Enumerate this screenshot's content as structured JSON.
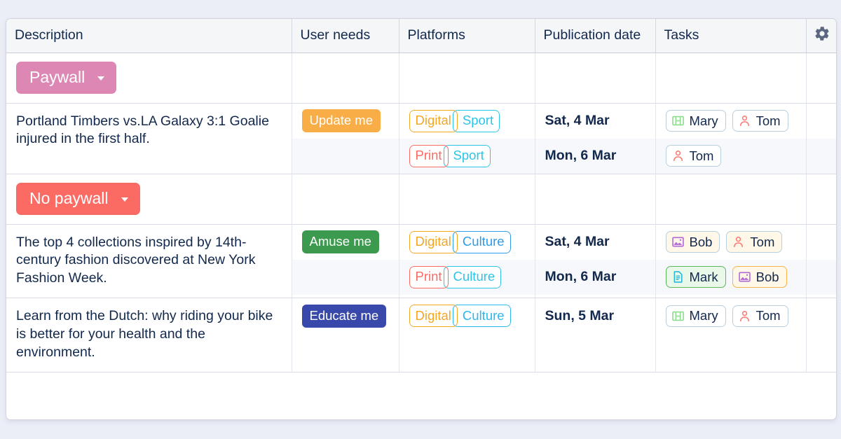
{
  "page": {
    "background_color": "#eceef7",
    "card_background": "#ffffff"
  },
  "table": {
    "columns": [
      {
        "key": "description",
        "label": "Description"
      },
      {
        "key": "user_needs",
        "label": "User needs"
      },
      {
        "key": "platforms",
        "label": "Platforms"
      },
      {
        "key": "publication_date",
        "label": "Publication date"
      },
      {
        "key": "tasks",
        "label": "Tasks"
      },
      {
        "key": "settings",
        "label": "",
        "icon": "gear-icon"
      }
    ],
    "groups": [
      {
        "label": "Paywall",
        "color": "#dd87b4",
        "caret": "chevron-down-icon",
        "rows": [
          {
            "description": "Portland Timbers vs.LA Galaxy 3:1 Goalie injured in the first half.",
            "user_need": {
              "label": "Update me",
              "color": "#f9ad47"
            },
            "lines": [
              {
                "platform": {
                  "left": "Digital",
                  "left_color": "#f5a623",
                  "right": "Sport",
                  "right_color": "#2bc4e8"
                },
                "date": "Sat, 4 Mar",
                "tasks": [
                  {
                    "name": "Mary",
                    "icon": "film-icon",
                    "icon_color": "#8fdc8f",
                    "border_color": "#b9cfe0",
                    "background": "#ffffff"
                  },
                  {
                    "name": "Tom",
                    "icon": "person-icon",
                    "icon_color": "#fa7a72",
                    "border_color": "#b9cfe0",
                    "background": "#ffffff"
                  }
                ]
              },
              {
                "platform": {
                  "left": "Print",
                  "left_color": "#fa6b63",
                  "right": "Sport",
                  "right_color": "#2bc4e8"
                },
                "date": "Mon, 6 Mar",
                "tasks": [
                  {
                    "name": "Tom",
                    "icon": "person-icon",
                    "icon_color": "#fa7a72",
                    "border_color": "#b9cfe0",
                    "background": "#ffffff"
                  }
                ]
              }
            ]
          }
        ]
      },
      {
        "label": "No paywall",
        "color": "#fb6a63",
        "caret": "chevron-down-icon",
        "rows": [
          {
            "description": "The top 4 collections inspired by 14th-century fashion discovered at New York Fashion Week.",
            "user_need": {
              "label": "Amuse me",
              "color": "#3c9a4e"
            },
            "lines": [
              {
                "platform": {
                  "left": "Digital",
                  "left_color": "#f5a623",
                  "right": "Culture",
                  "right_color": "#2d9cea"
                },
                "date": "Sat, 4 Mar",
                "tasks": [
                  {
                    "name": "Bob",
                    "icon": "image-icon",
                    "icon_color": "#b06ad6",
                    "border_color": "#f6b košt",
                    "background": "#fff7e8"
                  },
                  {
                    "name": "Tom",
                    "icon": "person-icon",
                    "icon_color": "#fa7a72",
                    "border_color": "#f7b martial",
                    "background": "#fff7e8"
                  }
                ]
              },
              {
                "platform": {
                  "left": "Print",
                  "left_color": "#fa6b63",
                  "right": "Culture",
                  "right_color": "#2bc4e8"
                },
                "date": "Mon, 6 Mar",
                "tasks": [
                  {
                    "name": "Mark",
                    "icon": "document-icon",
                    "icon_color": "#26b8d9",
                    "border_color": "#5cb85c",
                    "background": "#eaf8ea"
                  },
                  {
                    "name": "Bob",
                    "icon": "image-icon",
                    "icon_color": "#b06ad6",
                    "border_color": "#f7b54a",
                    "background": "#fff7e8"
                  }
                ]
              }
            ]
          },
          {
            "description": "Learn from the Dutch: why riding your bike is better for your health and the environment.",
            "user_need": {
              "label": "Educate me",
              "color": "#3949ab"
            },
            "lines": [
              {
                "platform": {
                  "left": "Digital",
                  "left_color": "#f5a623",
                  "right": "Culture",
                  "right_color": "#2bb7f0"
                },
                "date": "Sun, 5 Mar",
                "tasks": [
                  {
                    "name": "Mary",
                    "icon": "film-icon",
                    "icon_color": "#8fdc8f",
                    "border_color": "#b9cfe0",
                    "background": "#ffffff"
                  },
                  {
                    "name": "Tom",
                    "icon": "person-icon",
                    "icon_color": "#fa7a72",
                    "border_color": "#b9cfe0",
                    "background": "#ffffff"
                  }
                ]
              }
            ]
          }
        ]
      }
    ]
  }
}
